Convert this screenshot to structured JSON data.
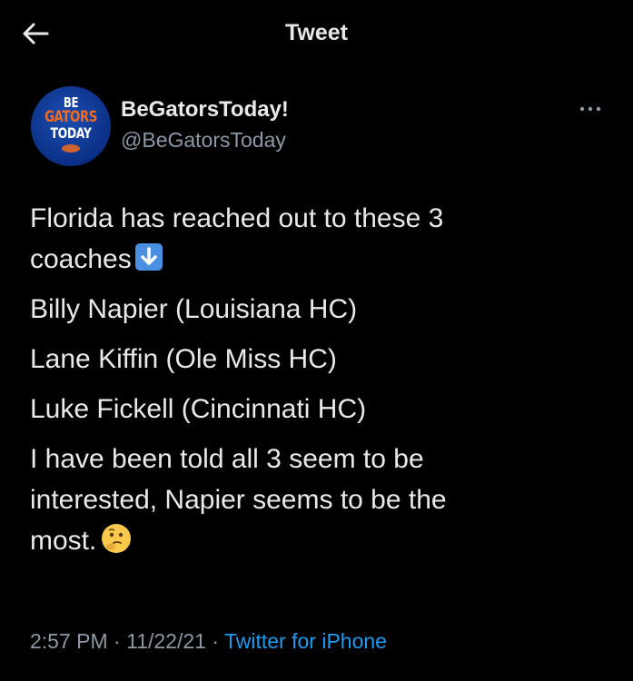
{
  "header": {
    "title": "Tweet"
  },
  "author": {
    "avatar_text": [
      "BE",
      "GATORS",
      "TODAY"
    ],
    "display_name": "BeGatorsToday!",
    "handle": "@BeGatorsToday"
  },
  "tweet": {
    "lines": [
      "Florida has reached out to these 3",
      "coaches",
      "Billy Napier (Louisiana HC)",
      "Lane Kiffin (Ole Miss HC)",
      "Luke Fickell (Cincinnati HC)",
      "I have been told all 3 seem to be",
      "interested, Napier seems to be the",
      "most."
    ]
  },
  "meta": {
    "time": "2:57 PM",
    "sep1": "·",
    "date": "11/22/21",
    "sep2": "·",
    "source": "Twitter for iPhone"
  },
  "colors": {
    "background": "#000000",
    "text": "#e7e9ea",
    "secondary": "#8b98a5",
    "link": "#1d9bf0"
  },
  "icons": {
    "back": "arrow-left-icon",
    "more": "more-dots-icon",
    "emoji_1": "down-arrow-emoji-icon",
    "emoji_2": "thinking-face-emoji-icon"
  }
}
